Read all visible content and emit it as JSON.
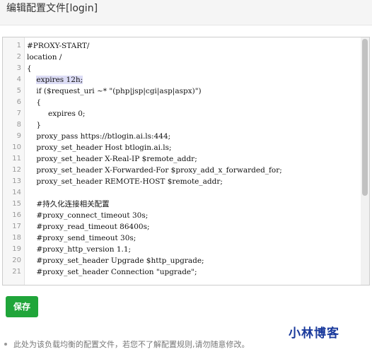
{
  "dialog": {
    "title": "编辑配置文件[login]"
  },
  "editor": {
    "highlighted_line": 4,
    "lines": [
      {
        "n": "1",
        "text": "#PROXY-START/"
      },
      {
        "n": "2",
        "text": "location /"
      },
      {
        "n": "3",
        "text": "{"
      },
      {
        "n": "4",
        "text": "    expires 12h;"
      },
      {
        "n": "5",
        "text": "    if ($request_uri ~* \"(php|jsp|cgi|asp|aspx)\")"
      },
      {
        "n": "6",
        "text": "    {"
      },
      {
        "n": "7",
        "text": "         expires 0;"
      },
      {
        "n": "8",
        "text": "    }"
      },
      {
        "n": "9",
        "text": "    proxy_pass https://btlogin.ai.ls:444;"
      },
      {
        "n": "10",
        "text": "    proxy_set_header Host btlogin.ai.ls;"
      },
      {
        "n": "11",
        "text": "    proxy_set_header X-Real-IP $remote_addr;"
      },
      {
        "n": "12",
        "text": "    proxy_set_header X-Forwarded-For $proxy_add_x_forwarded_for;"
      },
      {
        "n": "13",
        "text": "    proxy_set_header REMOTE-HOST $remote_addr;"
      },
      {
        "n": "14",
        "text": ""
      },
      {
        "n": "15",
        "text": "    #持久化连接相关配置"
      },
      {
        "n": "16",
        "text": "    #proxy_connect_timeout 30s;"
      },
      {
        "n": "17",
        "text": "    #proxy_read_timeout 86400s;"
      },
      {
        "n": "18",
        "text": "    #proxy_send_timeout 30s;"
      },
      {
        "n": "19",
        "text": "    #proxy_http_version 1.1;"
      },
      {
        "n": "20",
        "text": "    #proxy_set_header Upgrade $http_upgrade;"
      },
      {
        "n": "21",
        "text": "    #proxy_set_header Connection \"upgrade\";"
      }
    ]
  },
  "actions": {
    "save_label": "保存"
  },
  "footer": {
    "note": "此处为该负载均衡的配置文件，若您不了解配置规则,请勿随意修改。"
  },
  "watermark": {
    "text": "小林博客"
  },
  "colors": {
    "save_button": "#20a53a",
    "watermark": "#1a3a9c",
    "highlight": "#dcdcf5"
  }
}
